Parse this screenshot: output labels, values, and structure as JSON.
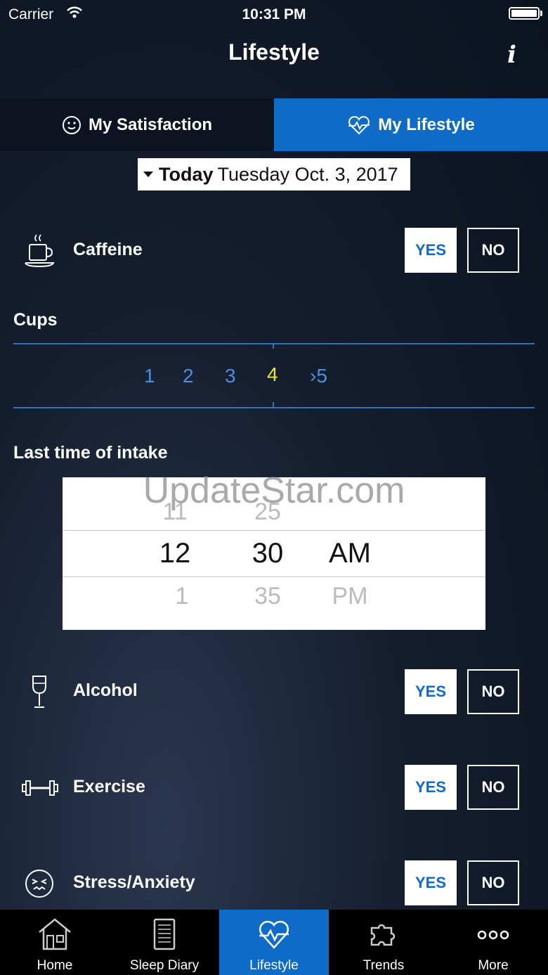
{
  "status_bar": {
    "carrier": "Carrier",
    "time": "10:31 PM"
  },
  "nav": {
    "title": "Lifestyle",
    "info_label": "i"
  },
  "tabs": [
    {
      "label": "My Satisfaction"
    },
    {
      "label": "My Lifestyle"
    }
  ],
  "date": {
    "today": "Today",
    "value": "Tuesday Oct. 3, 2017"
  },
  "caffeine": {
    "label": "Caffeine",
    "yes": "YES",
    "no": "NO"
  },
  "cups": {
    "title": "Cups",
    "options": [
      "1",
      "2",
      "3",
      "4",
      "›5"
    ],
    "selected": "4"
  },
  "intake": {
    "title": "Last time of intake"
  },
  "picker": {
    "hours": [
      "11",
      "12",
      "1"
    ],
    "minutes": [
      "25",
      "30",
      "35"
    ],
    "ampm": [
      "AM",
      "PM"
    ]
  },
  "watermark": "UpdateStar.com",
  "alcohol": {
    "label": "Alcohol",
    "yes": "YES",
    "no": "NO"
  },
  "exercise": {
    "label": "Exercise",
    "yes": "YES",
    "no": "NO"
  },
  "stress": {
    "label": "Stress/Anxiety",
    "yes": "YES",
    "no": "NO"
  },
  "tabbar": [
    {
      "label": "Home",
      "icon": "home-icon"
    },
    {
      "label": "Sleep Diary",
      "icon": "diary-icon"
    },
    {
      "label": "Lifestyle",
      "icon": "heart-pulse-icon"
    },
    {
      "label": "Trends",
      "icon": "puzzle-icon"
    },
    {
      "label": "More",
      "icon": "more-icon"
    }
  ],
  "colors": {
    "accent": "#0e6cc8",
    "selected_cup": "#e8e52a",
    "cup": "#4a8ee0"
  }
}
